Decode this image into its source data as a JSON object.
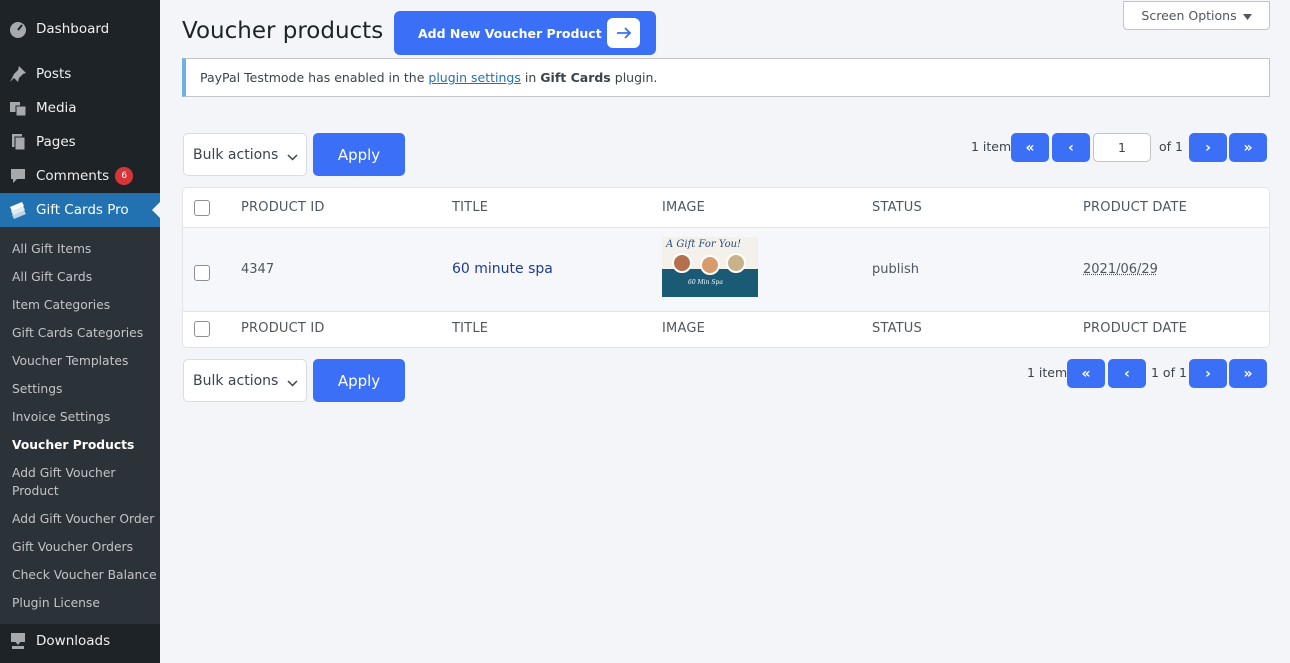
{
  "sidebar": {
    "menu": [
      {
        "label": "Dashboard",
        "icon": "dashboard-icon"
      },
      {
        "label": "Posts",
        "icon": "pin-icon"
      },
      {
        "label": "Media",
        "icon": "media-icon"
      },
      {
        "label": "Pages",
        "icon": "pages-icon"
      },
      {
        "label": "Comments",
        "icon": "comment-icon",
        "badge": "6"
      },
      {
        "label": "Gift Cards Pro",
        "icon": "tickets-icon"
      },
      {
        "label": "Downloads",
        "icon": "download-icon"
      }
    ],
    "submenu": [
      "All Gift Items",
      "All Gift Cards",
      "Item Categories",
      "Gift Cards Categories",
      "Voucher Templates",
      "Settings",
      "Invoice Settings",
      "Voucher Products",
      "Add Gift Voucher Product",
      "Add Gift Voucher Order",
      "Gift Voucher Orders",
      "Check Voucher Balance",
      "Plugin License"
    ]
  },
  "header": {
    "title": "Voucher products",
    "add_new_label": "Add New Voucher Product",
    "screen_options": "Screen Options"
  },
  "notice": {
    "prefix": "PayPal Testmode has enabled in the",
    "link": "plugin settings",
    "middle": "in",
    "bold": "Gift Cards",
    "suffix": "plugin."
  },
  "bulk": {
    "select_label": "Bulk actions",
    "apply_label": "Apply"
  },
  "pagination": {
    "count": "1 item",
    "first": "«",
    "prev": "‹",
    "next": "›",
    "last": "»",
    "current_page": "1",
    "of_label": "of 1",
    "bottom_of_label": "1 of 1"
  },
  "table": {
    "columns": [
      "PRODUCT ID",
      "TITLE",
      "IMAGE",
      "STATUS",
      "PRODUCT DATE"
    ],
    "rows": [
      {
        "id": "4347",
        "title": "60 minute spa",
        "image_text": "A Gift For You!",
        "image_caption": "60 Min Spa",
        "status": "publish",
        "date": "2021/06/29"
      }
    ]
  },
  "colors": {
    "accent": "#3a6ff6",
    "sidebar_bg": "#1d2327",
    "active_menu": "#2271b1",
    "badge": "#d63638"
  }
}
